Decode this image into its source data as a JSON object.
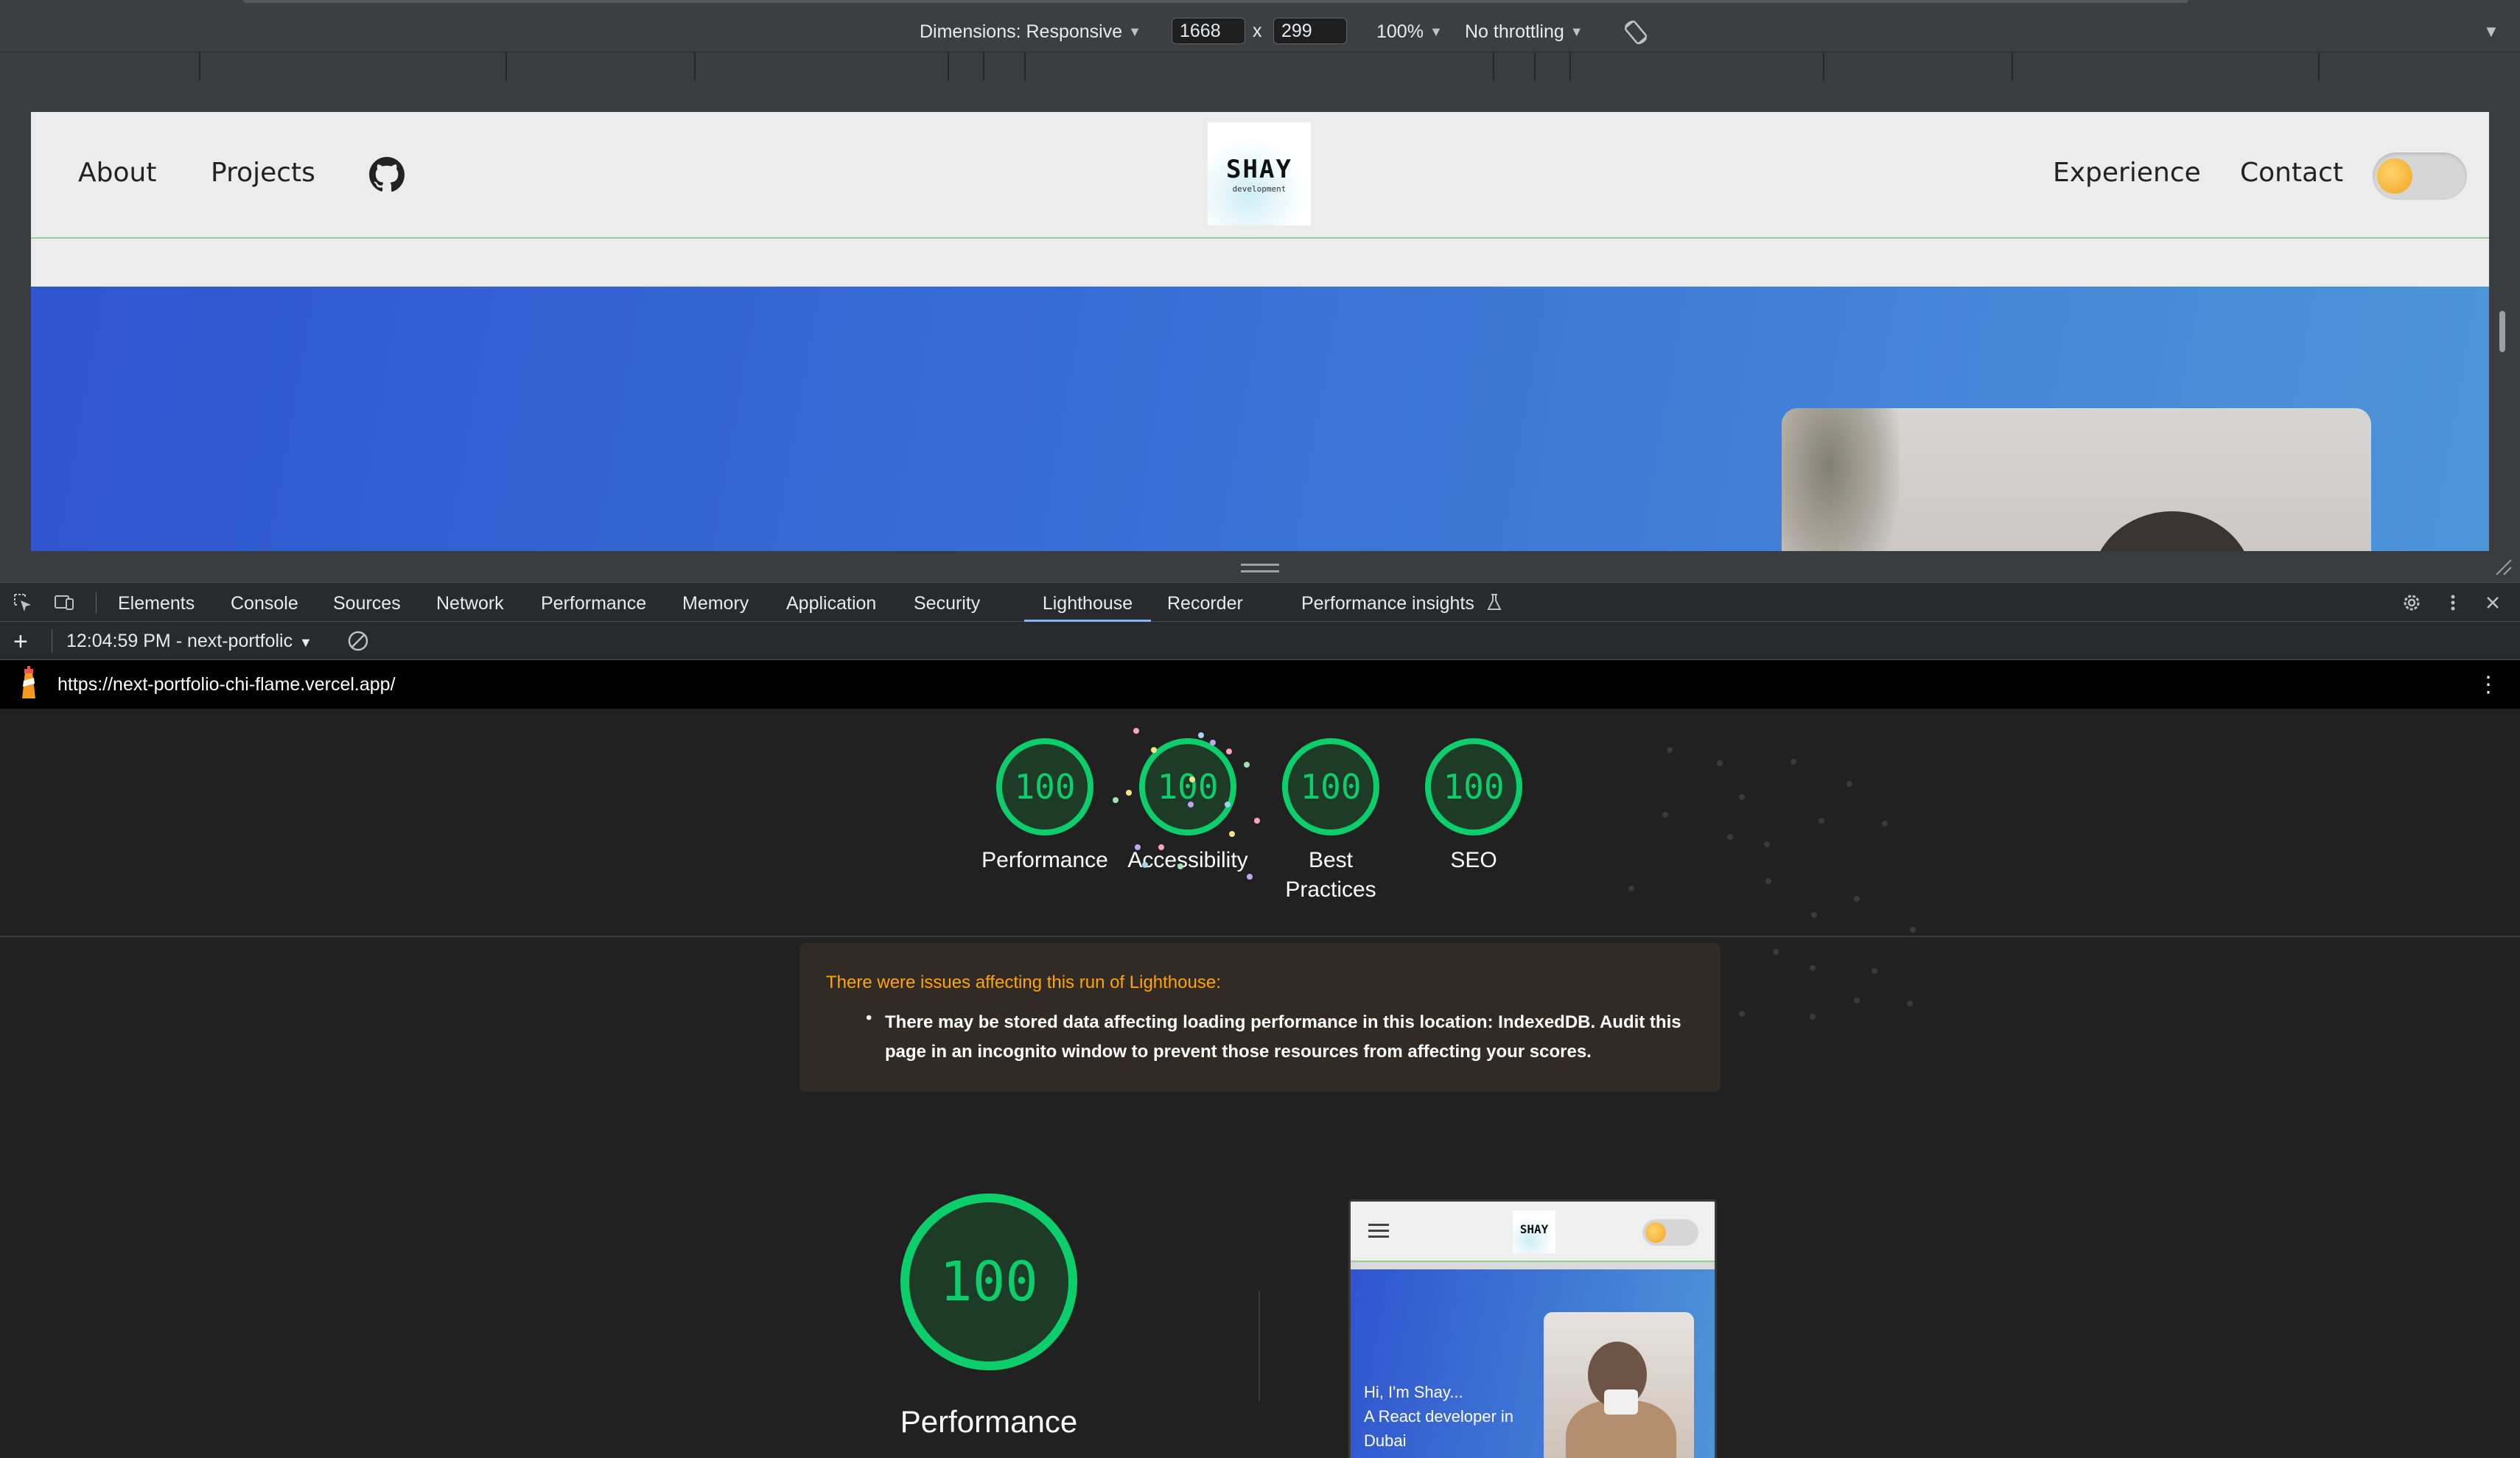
{
  "device_toolbar": {
    "dimensions_label": "Dimensions: Responsive",
    "width": "1668",
    "times": "x",
    "height": "299",
    "zoom": "100%",
    "throttling": "No throttling"
  },
  "site": {
    "nav": {
      "about": "About",
      "projects": "Projects",
      "experience": "Experience",
      "contact": "Contact"
    },
    "logo_line1": "SHAY",
    "logo_line2": "development"
  },
  "devtools": {
    "tabs": [
      "Elements",
      "Console",
      "Sources",
      "Network",
      "Performance",
      "Memory",
      "Application",
      "Security",
      "Lighthouse",
      "Recorder",
      "Performance insights"
    ],
    "active_tab": "Lighthouse",
    "run_label": "12:04:59 PM - next-portfolic",
    "url": "https://next-portfolio-chi-flame.vercel.app/"
  },
  "report": {
    "scores": [
      {
        "value": "100",
        "label": "Performance",
        "label2": ""
      },
      {
        "value": "100",
        "label": "Accessibility",
        "label2": ""
      },
      {
        "value": "100",
        "label": "Best",
        "label2": "Practices"
      },
      {
        "value": "100",
        "label": "SEO",
        "label2": ""
      }
    ],
    "warning_title": "There were issues affecting this run of Lighthouse:",
    "warning_item": "There may be stored data affecting loading performance in this location: IndexedDB. Audit this page in an incognito window to prevent those resources from affecting your scores.",
    "main_score": "100",
    "main_label": "Performance",
    "thumbnail": {
      "logo": "SHAY",
      "hero_text_1": "Hi, I'm Shay...",
      "hero_text_2": "A React developer in Dubai"
    }
  },
  "colors": {
    "pass_green": "#0cce6b",
    "warning_orange": "#ffa400",
    "active_tab": "#8ab4f8"
  }
}
